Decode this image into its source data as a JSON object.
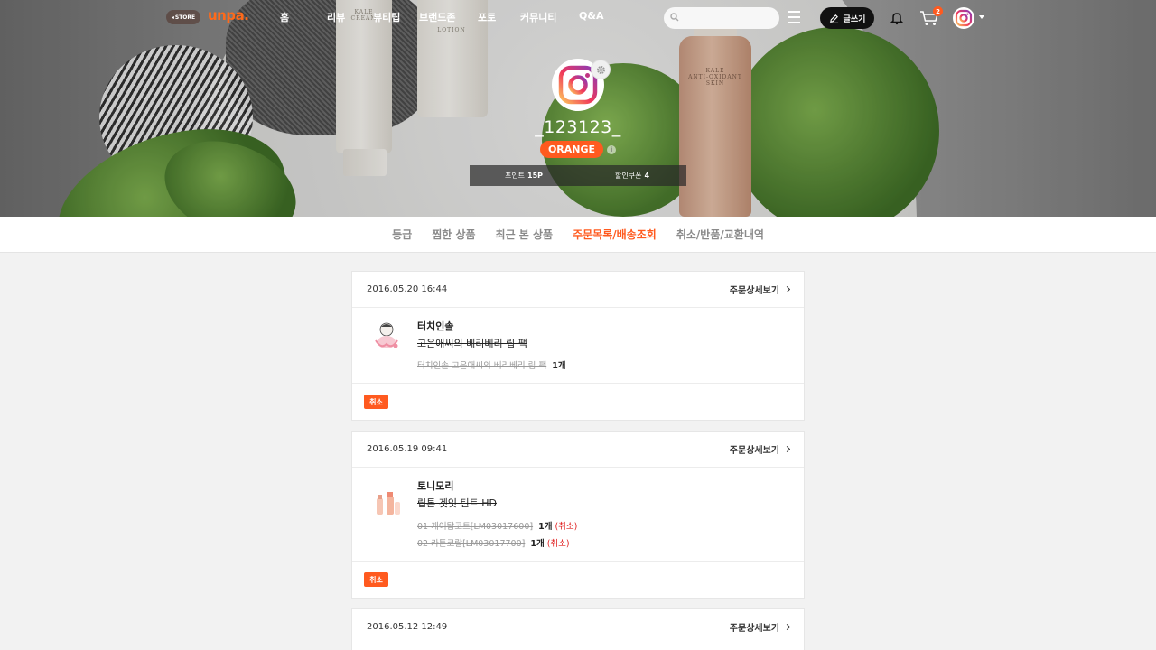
{
  "topnav": {
    "store_label": "STORE",
    "logo": "unpa.",
    "menu": [
      "홈",
      "리뷰",
      "뷰티팁",
      "브랜드존",
      "포토",
      "커뮤니티",
      "Q&A"
    ],
    "search_placeholder": "",
    "write_label": "글쓰기",
    "cart_count": "2"
  },
  "hero": {
    "label_cream": "KALE\nCREAM",
    "label_lotion": "LOTION",
    "label_skin": "KALE\nANTI-OXIDANT\nSKIN"
  },
  "profile": {
    "username": "_123123_",
    "grade": "ORANGE",
    "points_label": "포인트",
    "points_value": "15P",
    "coupon_label": "할인쿠폰",
    "coupon_value": "4"
  },
  "tabs": [
    {
      "label": "등급",
      "active": false
    },
    {
      "label": "찜한 상품",
      "active": false
    },
    {
      "label": "최근 본 상품",
      "active": false
    },
    {
      "label": "주문목록/배송조회",
      "active": true
    },
    {
      "label": "취소/반품/교환내역",
      "active": false
    }
  ],
  "orders": [
    {
      "date": "2016.05.20 16:44",
      "detail_label": "주문상세보기",
      "brand": "터치인솔",
      "product": "고은애씨의 베리베리 립 팩",
      "options": [
        {
          "text": "터치인솔 고은애씨의 베리베리 립 팩",
          "qty": "1개",
          "status": ""
        }
      ],
      "status_badge": "취소"
    },
    {
      "date": "2016.05.19 09:41",
      "detail_label": "주문상세보기",
      "brand": "토니모리",
      "product": "립톤 겟잇 틴트 HD",
      "options": [
        {
          "text": "01 케어탑코트[LM03017600]",
          "qty": "1개",
          "status": "(취소)"
        },
        {
          "text": "02 카툰코랄[LM03017700]",
          "qty": "1개",
          "status": "(취소)"
        }
      ],
      "status_badge": "취소"
    },
    {
      "date": "2016.05.12 12:49",
      "detail_label": "주문상세보기"
    }
  ],
  "colors": {
    "accent": "#ff5a1f",
    "cancel_text": "#e02020",
    "logo": "#ff6a1a"
  }
}
